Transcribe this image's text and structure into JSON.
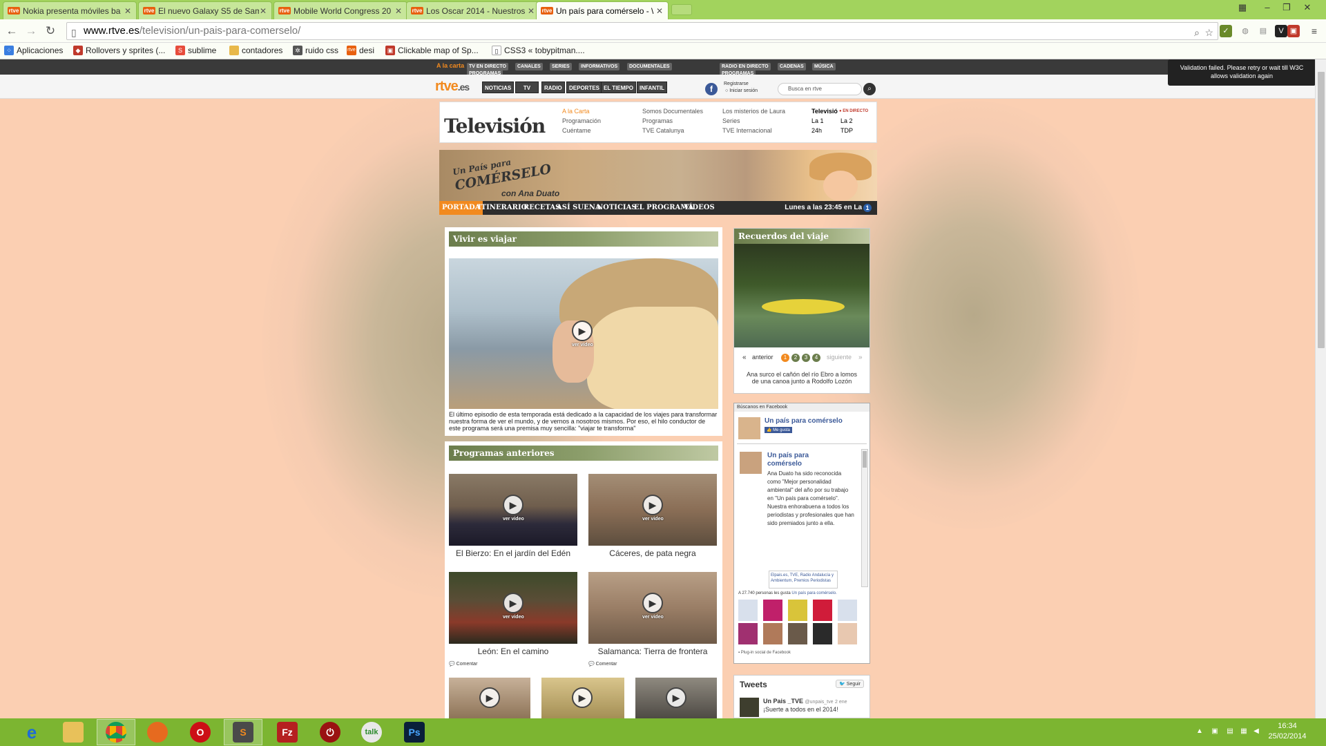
{
  "browser": {
    "tabs": [
      {
        "favicon": "rtve",
        "title": "Nokia presenta móviles ba"
      },
      {
        "favicon": "rtve",
        "title": "El nuevo Galaxy S5 de Sam"
      },
      {
        "favicon": "rtve",
        "title": "Mobile World Congress 20"
      },
      {
        "favicon": "rtve",
        "title": "Los Oscar 2014 - Nuestros"
      },
      {
        "favicon": "rtve",
        "title": "Un país para comérselo - \\"
      }
    ],
    "url_host": "www.rtve.es",
    "url_path": "/television/un-pais-para-comerselo/",
    "bookmarks": [
      "Aplicaciones",
      "Rollovers y sprites (...",
      "sublime",
      "contadores",
      "ruido css",
      "desi",
      "Clickable map of Sp...",
      "CSS3 « tobypitman...."
    ]
  },
  "rtve": {
    "top_label": "A la carta",
    "top_menu": [
      "TV EN DIRECTO",
      "CANALES",
      "SERIES",
      "INFORMATIVOS",
      "DOCUMENTALES",
      "PROGRAMAS",
      "RADIO EN DIRECTO",
      "CADENAS",
      "MÚSICA",
      "PROGRAMAS"
    ],
    "logo_main": "rtve",
    "logo_suffix": ".es",
    "nav": [
      "NOTICIAS",
      "TV",
      "RADIO",
      "DEPORTES",
      "EL TIEMPO",
      "INFANTIL"
    ],
    "register": "Registrarse",
    "login": "Iniciar sesión",
    "search_placeholder": "Busca en rtve",
    "w3c_notice": "Validation failed. Please retry or wait till W3C allows validation again"
  },
  "tv_header": {
    "title": "Televisión",
    "col1": [
      "A la Carta",
      "Programación",
      "Cuéntame"
    ],
    "col2": [
      "Somos Documentales",
      "Programas",
      "TVE Catalunya"
    ],
    "col3": [
      "Los misterios de Laura",
      "Series",
      "TVE Internacional"
    ],
    "col4_title": "Televisió",
    "en_directo": "EN DIRECTO",
    "channels": [
      "La 1",
      "La 2",
      "24h",
      "TDP"
    ]
  },
  "banner": {
    "logo_line1": "Un País para",
    "logo_line2": "COMÉRSELO",
    "host": "con Ana Duato"
  },
  "subnav": {
    "items": [
      "PORTADA",
      "ITINERARIO",
      "RECETAS",
      "ASÍ SUENA",
      "NOTICIAS",
      "EL PROGRAMA",
      "VÍDEOS"
    ],
    "schedule": "Lunes a las 23:45 en La",
    "channel_badge": "1"
  },
  "main": {
    "section1_title": "Vivir es viajar",
    "ver_video": "ver video",
    "section1_desc": "El último episodio de esta temporada está dedicado a la capacidad de los viajes para transformar nuestra forma de ver el mundo, y de vernos a nosotros mismos. Por eso, el hilo conductor de este programa será una premisa muy sencilla: \"viajar te transforma\"",
    "section2_title": "Programas anteriores",
    "programs": [
      {
        "title": "El Bierzo: En el jardín del Edén"
      },
      {
        "title": "Cáceres, de pata negra"
      },
      {
        "title": "León: En el camino"
      },
      {
        "title": "Salamanca: Tierra de frontera"
      }
    ],
    "comment_label": "Comentar"
  },
  "recuerdos": {
    "title": "Recuerdos del viaje",
    "prev": "anterior",
    "next": "siguiente",
    "pages": [
      "1",
      "2",
      "3",
      "4"
    ],
    "caption": "Ana surco el cañón del río Ebro a lomos de una canoa junto a Rodolfo Lozón"
  },
  "facebook": {
    "header": "Búscanos en Facebook",
    "page_name": "Un país para comérselo",
    "like": "Me gusta",
    "post_author_line1": "Un país para",
    "post_author_line2": "comérselo",
    "post_text": "Ana Duato ha sido reconocida como \"Mejor personalidad ambiental\" del año por su trabajo en \"Un país para comérselo\". Nuestra enhorabuena a todos los periodistas y profesionales que han sido premiados junto a ella.",
    "post_tags": "Elpais.es, TVE, Radio Andalucía y Ambientum, Premios Periodistas",
    "fans_prefix": "A 27.740 personas les gusta",
    "fans_link": "Un país para comérselo.",
    "plugin": "Plug-in social de Facebook"
  },
  "tweets": {
    "title": "Tweets",
    "follow": "Seguir",
    "author": "Un Pais _TVE",
    "handle": "@unpais_tve",
    "date": "2 ene",
    "text": "¡Suerte a todos en el 2014!"
  },
  "taskbar": {
    "time": "16:34",
    "date": "25/02/2014"
  },
  "colors": {
    "page_bg": "#fbcfb2",
    "rtve_orange": "#f28a1f",
    "section_green": "#6b7d4c",
    "tab_green": "#a2d35d",
    "taskbar_green": "#7cb531"
  }
}
